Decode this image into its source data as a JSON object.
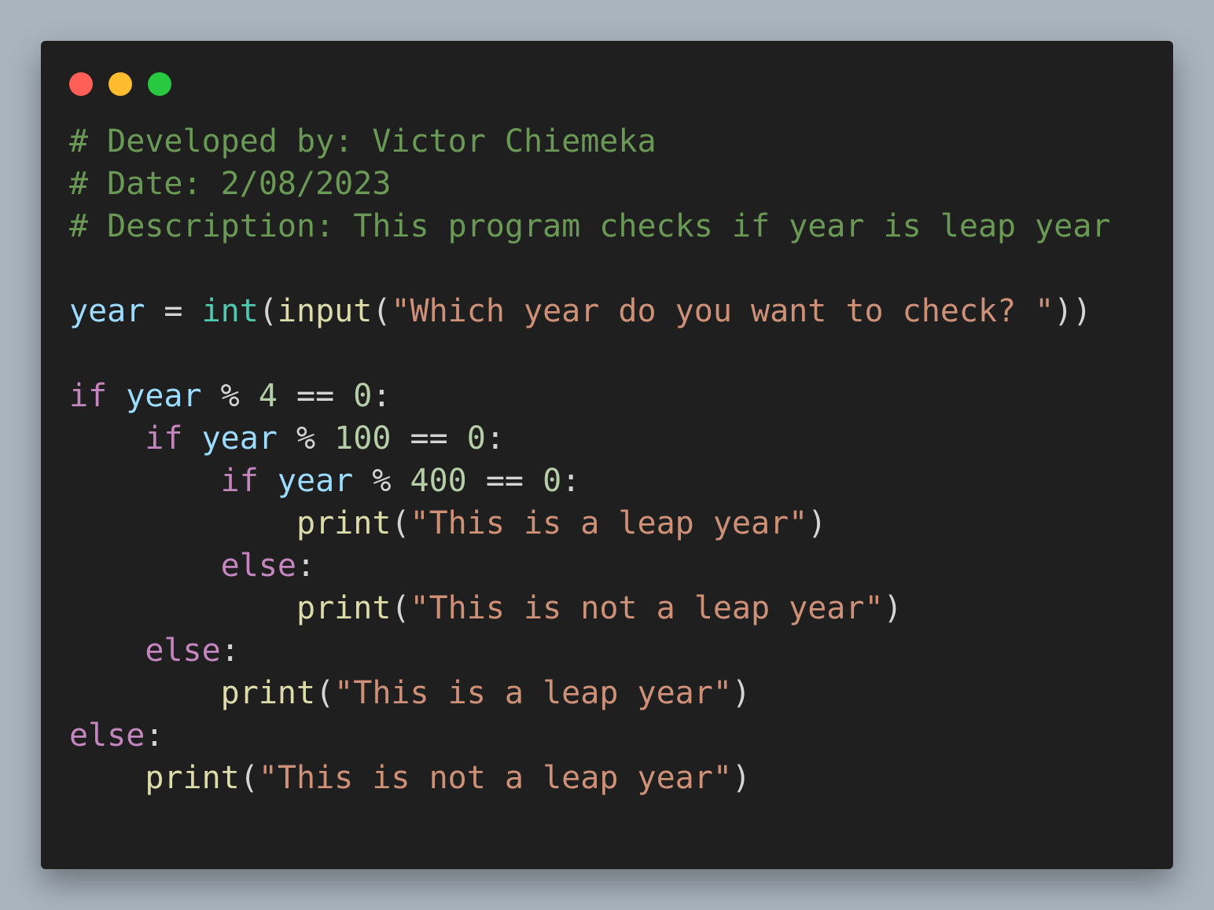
{
  "window": {
    "controls": {
      "close_color": "#ff5f57",
      "minimize_color": "#febc2e",
      "zoom_color": "#28c840"
    }
  },
  "theme": {
    "comment": "#6a9955",
    "variable": "#9cdcfe",
    "builtin": "#4ec9b0",
    "function": "#dcdcaa",
    "string": "#ce9178",
    "keyword": "#c586c0",
    "number": "#b5cea8",
    "plain": "#d4d4d4"
  },
  "code": {
    "lines": [
      [
        {
          "t": "comment",
          "v": "# Developed by: Victor Chiemeka"
        }
      ],
      [
        {
          "t": "comment",
          "v": "# Date: 2/08/2023"
        }
      ],
      [
        {
          "t": "comment",
          "v": "# Description: This program checks if year is leap year"
        }
      ],
      [],
      [
        {
          "t": "var",
          "v": "year"
        },
        {
          "t": "op",
          "v": " = "
        },
        {
          "t": "builtin",
          "v": "int"
        },
        {
          "t": "plain",
          "v": "("
        },
        {
          "t": "func",
          "v": "input"
        },
        {
          "t": "plain",
          "v": "("
        },
        {
          "t": "string",
          "v": "\"Which year do you want to check? \""
        },
        {
          "t": "plain",
          "v": "))"
        }
      ],
      [],
      [
        {
          "t": "keyword",
          "v": "if"
        },
        {
          "t": "plain",
          "v": " "
        },
        {
          "t": "var",
          "v": "year"
        },
        {
          "t": "op",
          "v": " % "
        },
        {
          "t": "number",
          "v": "4"
        },
        {
          "t": "op",
          "v": " == "
        },
        {
          "t": "number",
          "v": "0"
        },
        {
          "t": "plain",
          "v": ":"
        }
      ],
      [
        {
          "t": "plain",
          "v": "    "
        },
        {
          "t": "keyword",
          "v": "if"
        },
        {
          "t": "plain",
          "v": " "
        },
        {
          "t": "var",
          "v": "year"
        },
        {
          "t": "op",
          "v": " % "
        },
        {
          "t": "number",
          "v": "100"
        },
        {
          "t": "op",
          "v": " == "
        },
        {
          "t": "number",
          "v": "0"
        },
        {
          "t": "plain",
          "v": ":"
        }
      ],
      [
        {
          "t": "plain",
          "v": "        "
        },
        {
          "t": "keyword",
          "v": "if"
        },
        {
          "t": "plain",
          "v": " "
        },
        {
          "t": "var",
          "v": "year"
        },
        {
          "t": "op",
          "v": " % "
        },
        {
          "t": "number",
          "v": "400"
        },
        {
          "t": "op",
          "v": " == "
        },
        {
          "t": "number",
          "v": "0"
        },
        {
          "t": "plain",
          "v": ":"
        }
      ],
      [
        {
          "t": "plain",
          "v": "            "
        },
        {
          "t": "func",
          "v": "print"
        },
        {
          "t": "plain",
          "v": "("
        },
        {
          "t": "string",
          "v": "\"This is a leap year\""
        },
        {
          "t": "plain",
          "v": ")"
        }
      ],
      [
        {
          "t": "plain",
          "v": "        "
        },
        {
          "t": "keyword",
          "v": "else"
        },
        {
          "t": "plain",
          "v": ":"
        }
      ],
      [
        {
          "t": "plain",
          "v": "            "
        },
        {
          "t": "func",
          "v": "print"
        },
        {
          "t": "plain",
          "v": "("
        },
        {
          "t": "string",
          "v": "\"This is not a leap year\""
        },
        {
          "t": "plain",
          "v": ")"
        }
      ],
      [
        {
          "t": "plain",
          "v": "    "
        },
        {
          "t": "keyword",
          "v": "else"
        },
        {
          "t": "plain",
          "v": ":"
        }
      ],
      [
        {
          "t": "plain",
          "v": "        "
        },
        {
          "t": "func",
          "v": "print"
        },
        {
          "t": "plain",
          "v": "("
        },
        {
          "t": "string",
          "v": "\"This is a leap year\""
        },
        {
          "t": "plain",
          "v": ")"
        }
      ],
      [
        {
          "t": "keyword",
          "v": "else"
        },
        {
          "t": "plain",
          "v": ":"
        }
      ],
      [
        {
          "t": "plain",
          "v": "    "
        },
        {
          "t": "func",
          "v": "print"
        },
        {
          "t": "plain",
          "v": "("
        },
        {
          "t": "string",
          "v": "\"This is not a leap year\""
        },
        {
          "t": "plain",
          "v": ")"
        }
      ]
    ]
  }
}
